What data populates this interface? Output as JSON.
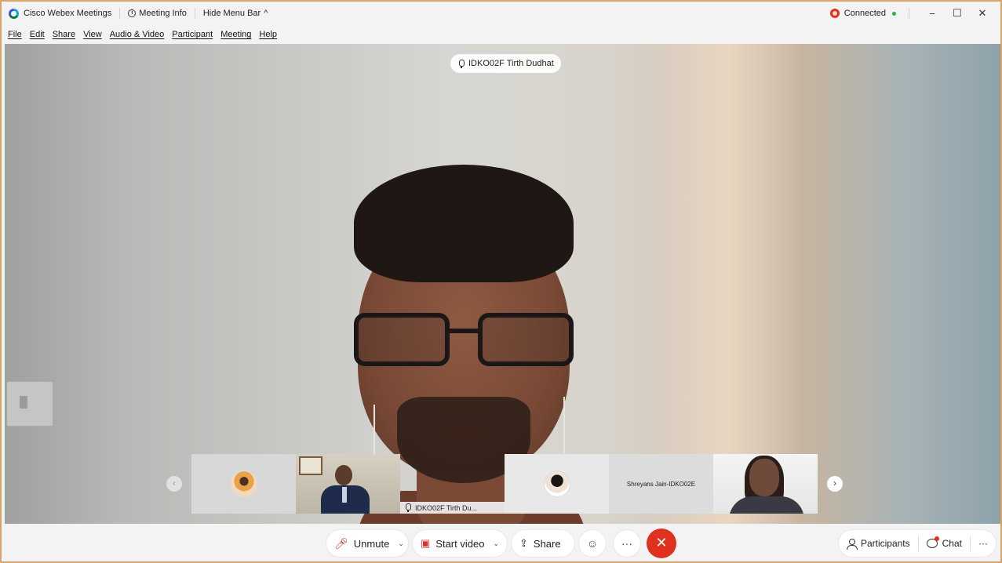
{
  "titlebar": {
    "app_name": "Cisco Webex Meetings",
    "meeting_info": "Meeting Info",
    "hide_menu": "Hide Menu Bar",
    "hide_menu_chevron": "^",
    "status": "Connected",
    "status_color": "#e0301e",
    "minimize": "−",
    "maximize": "☐",
    "close": "✕"
  },
  "menubar": {
    "items": [
      "File",
      "Edit",
      "Share",
      "View",
      "Audio & Video",
      "Participant",
      "Meeting",
      "Help"
    ]
  },
  "stage": {
    "active_speaker": "IDKO02F Tirth Dudhat"
  },
  "filmstrip": {
    "tiles": [
      {
        "type": "avatar",
        "name": ""
      },
      {
        "type": "video",
        "name": ""
      },
      {
        "type": "active",
        "name": "IDKO02F Tirth Du..."
      },
      {
        "type": "avatar",
        "name": ""
      },
      {
        "type": "name",
        "name": "Shreyans Jain-IDKO02E"
      },
      {
        "type": "video",
        "name": ""
      }
    ],
    "prev_arrow": "‹",
    "next_arrow": "›"
  },
  "controls": {
    "unmute": "Unmute",
    "start_video": "Start video",
    "share": "Share",
    "reactions_icon": "☺",
    "more": "···",
    "end": "✕",
    "participants": "Participants",
    "chat": "Chat",
    "overflow": "···",
    "end_color": "#e0301e"
  }
}
